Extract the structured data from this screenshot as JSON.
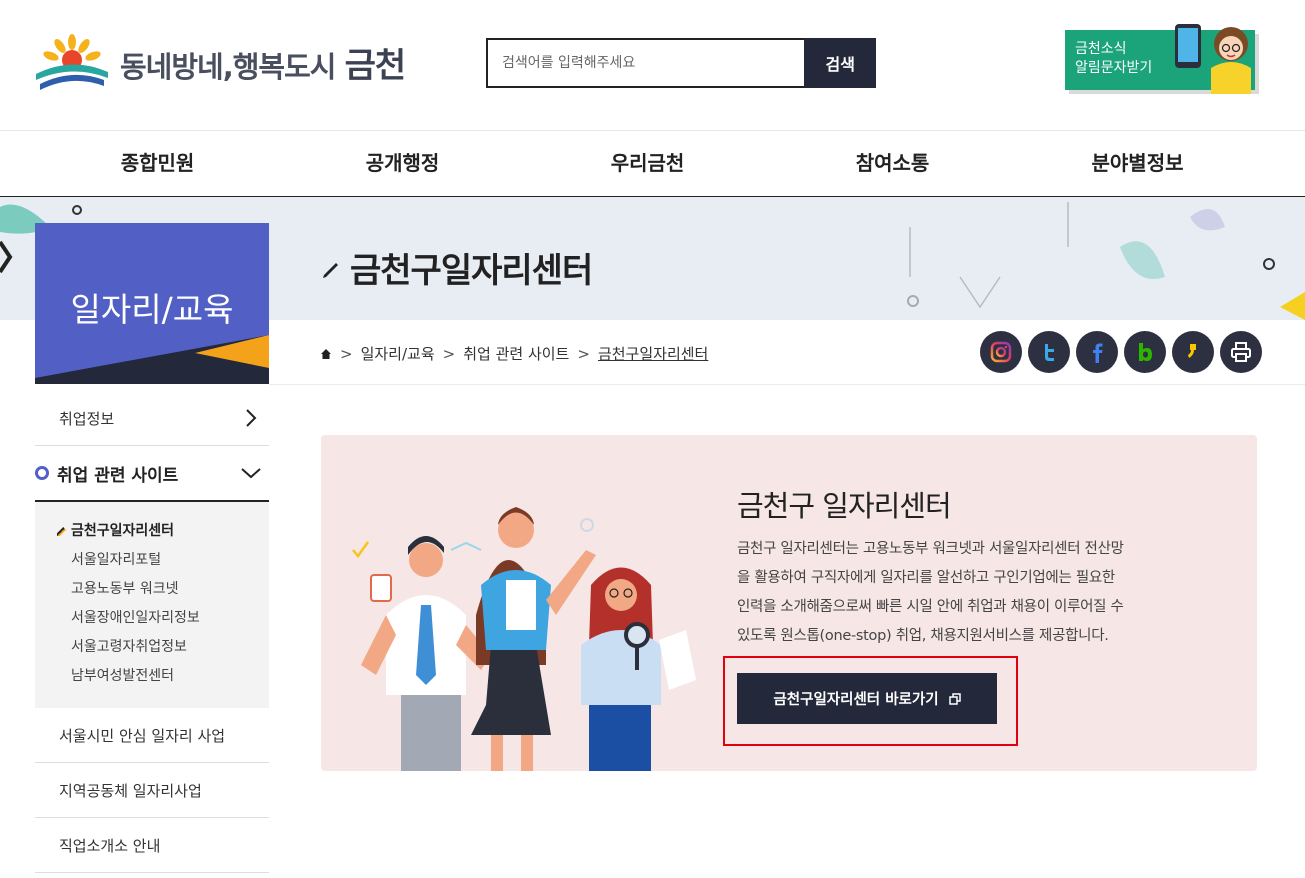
{
  "header": {
    "logo_text_small": "동네방네,행복도시",
    "logo_text_big": "금천",
    "search": {
      "placeholder": "검색어를 입력해주세요",
      "button_label": "검색"
    },
    "sms_banner": {
      "line1": "금천소식",
      "line2": "알림문자받기"
    }
  },
  "gnb": {
    "items": [
      "종합민원",
      "공개행정",
      "우리금천",
      "참여소통",
      "분야별정보"
    ]
  },
  "section": {
    "title": "일자리/교육"
  },
  "page_title": "금천구일자리센터",
  "breadcrumb": {
    "items": [
      "일자리/교육",
      "취업 관련 사이트",
      "금천구일자리센터"
    ],
    "separator": ">"
  },
  "sns": {
    "buttons": [
      "instagram-icon",
      "twitter-icon",
      "facebook-icon",
      "blog-icon",
      "kakaostory-icon",
      "print-icon"
    ]
  },
  "lnb": {
    "item1": "취업정보",
    "active": "취업 관련 사이트",
    "sub_items": [
      "금천구일자리센터",
      "서울일자리포털",
      "고용노동부 워크넷",
      "서울장애인일자리정보",
      "서울고령자취업정보",
      "남부여성발전센터"
    ],
    "item3": "서울시민 안심 일자리 사업",
    "item4": "지역공동체 일자리사업",
    "item5": "직업소개소 안내"
  },
  "card": {
    "title": "금천구 일자리센터",
    "desc_lines": [
      "금천구 일자리센터는 고용노동부 워크넷과 서울일자리센터 전산망",
      "을 활용하여 구직자에게 일자리를 알선하고 구인기업에는 필요한",
      "인력을 소개해줌으로써 빠른 시일 안에 취업과 채용이 이루어질 수",
      "있도록 원스톱(one-stop) 취업, 채용지원서비스를 제공합니다."
    ],
    "button_label": "금천구일자리센터 바로가기"
  },
  "colors": {
    "accent": "#5260c5",
    "dark": "#23283a",
    "green": "#1ba37a",
    "card_bg": "#f6e7e6",
    "highlight": "#e4000f"
  }
}
